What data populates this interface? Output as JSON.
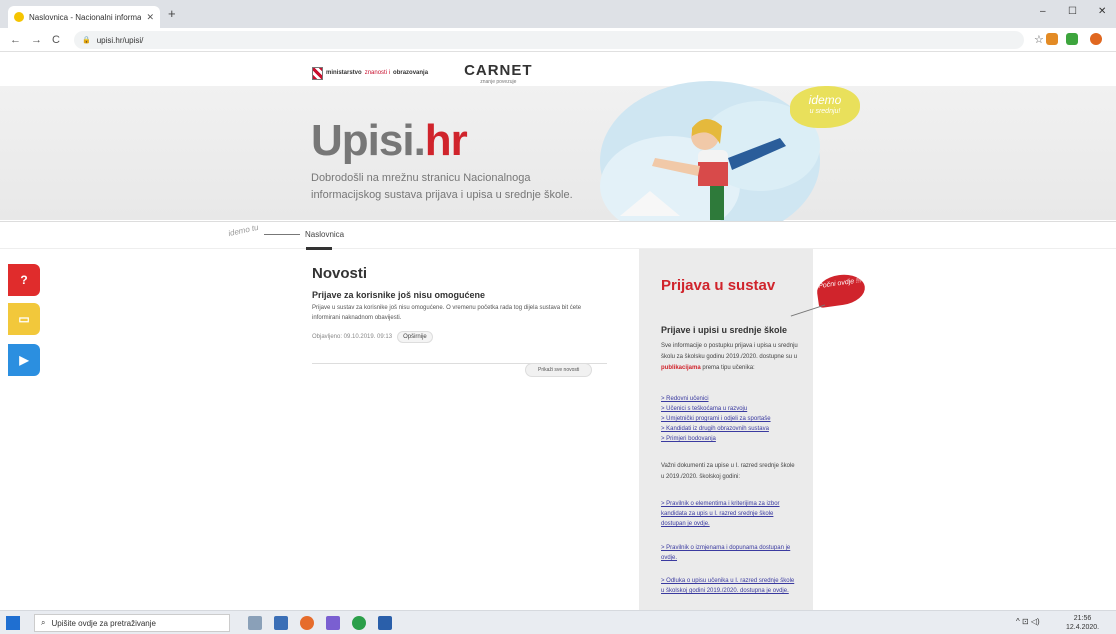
{
  "browser": {
    "tab_title": "Naslovnica - Nacionalni informa",
    "tab_close": "✕",
    "new_tab": "+",
    "url": "upisi.hr/upisi/",
    "back": "←",
    "forward": "→",
    "reload": "C",
    "star": "☆",
    "min": "–",
    "max": "☐",
    "close": "✕"
  },
  "header": {
    "ministry_pre": "ministarstvo",
    "ministry_mid": "znanosti i",
    "ministry_post": "obrazovanja",
    "carnet": "CARNET",
    "carnet_sub": "znanje povezuje"
  },
  "hero": {
    "title_main": "Upisi.",
    "title_accent": "hr",
    "subtitle": "Dobrodošli na mrežnu stranicu Nacionalnoga informacijskog sustava prijava i upisa u srednje škole.",
    "badge_top": "idemo",
    "badge_bottom": "u srednju!"
  },
  "breadcrumb": {
    "scribble": "idemo tu",
    "current": "Naslovnica"
  },
  "side_buttons": [
    {
      "icon": "?",
      "color": "#e02c2c"
    },
    {
      "icon": "▭",
      "color": "#f2c83b"
    },
    {
      "icon": "▶",
      "color": "#2b8fe0"
    }
  ],
  "news": {
    "heading": "Novosti",
    "item_title": "Prijave za korisnike još nisu omogućene",
    "item_text": "Prijave u sustav za korisnike još nisu omogućene. O vremenu početka rada tog dijela sustava bit ćete informirani naknadnom obavijesti.",
    "published": "Objavljeno: 09.10.2019. 09:13",
    "more": "Opširnije",
    "all_news": "Prikaži sve novosti"
  },
  "panel": {
    "heading": "Prijava u sustav",
    "badge": "Počni ovdje !!!",
    "subheading": "Prijave i upisi u srednje škole",
    "intro_a": "Sve informacije o postupku prijava i upisa u srednju školu za školsku godinu 2019./2020. dostupne su u ",
    "intro_link": "publikacijama",
    "intro_b": " prema tipu učenika:",
    "links": [
      "> Redovni učenici",
      "> Učenici s teškoćama u razvoju",
      "> Umjetnički programi i odjeli za sportaše",
      "> Kandidati iz drugih obrazovnih sustava",
      "> Primjeri bodovanja"
    ],
    "doc_text": "Važni dokumenti za upise u I. razred srednje škole u 2019./2020. školskoj godini:",
    "doc_links": [
      "> Pravilnik o elementima i kriterijima za izbor kandidata za upis u I. razred srednje škole dostupan je ovdje.",
      "> Pravilnik o izmjenama i dopunama dostupan je ovdje.",
      "> Odluka o upisu učenika u I. razred srednje škole u školskoj godini 2019./2020. dostupna je ovdje."
    ]
  },
  "taskbar": {
    "search_placeholder": "Upišite ovdje za pretraživanje",
    "time": "21:56",
    "date": "12.4.2020.",
    "tray": "^ ⊡ ◁)"
  }
}
